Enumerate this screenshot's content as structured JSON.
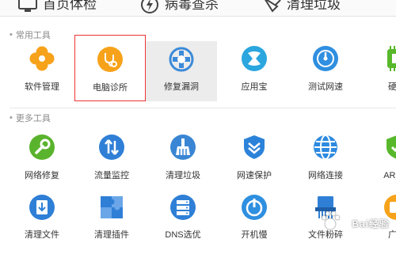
{
  "tabs": [
    {
      "label": "首页体检",
      "icon": "monitor-icon"
    },
    {
      "label": "病毒查杀",
      "icon": "lightning-shield-icon"
    },
    {
      "label": "清理垃圾",
      "icon": "broom-icon"
    }
  ],
  "sections": [
    {
      "title": "常用工具",
      "tools": [
        {
          "label": "软件管理",
          "icon": "clover-icon",
          "color": "#f7a21b"
        },
        {
          "label": "电脑诊所",
          "icon": "stethoscope-icon",
          "color": "#f7a21b",
          "selected": true
        },
        {
          "label": "修复漏洞",
          "icon": "bug-shield-icon",
          "color": "#3b8ad9",
          "hovered": true
        },
        {
          "label": "应用宝",
          "icon": "app-store-icon",
          "color": "#2ba6de"
        },
        {
          "label": "测试网速",
          "icon": "speedometer-icon",
          "color": "#2f8fe0"
        },
        {
          "label": "硬件",
          "icon": "chip-icon",
          "color": "#58b82b"
        }
      ]
    },
    {
      "title": "更多工具",
      "tools": [
        {
          "label": "网络修复",
          "icon": "wrench-icon",
          "color": "#5ab32d"
        },
        {
          "label": "流量监控",
          "icon": "up-down-arrows-icon",
          "color": "#2f7fd6"
        },
        {
          "label": "清理垃圾",
          "icon": "broom-icon",
          "color": "#3a86d4"
        },
        {
          "label": "网速保护",
          "icon": "shield-chevron-icon",
          "color": "#2b82d9"
        },
        {
          "label": "网络连接",
          "icon": "globe-icon",
          "color": "#2d8ae0"
        },
        {
          "label": "ARP防",
          "icon": "arp-shield-icon",
          "color": "#58b82b"
        }
      ]
    },
    {
      "tools": [
        {
          "label": "清理文件",
          "icon": "file-download-icon",
          "color": "#2f7fd6"
        },
        {
          "label": "清理插件",
          "icon": "puzzle-icon",
          "color": "#2f7fd6"
        },
        {
          "label": "DNS选优",
          "icon": "server-icon",
          "color": "#2f7fd6"
        },
        {
          "label": "开机慢",
          "icon": "power-clock-icon",
          "color": "#2f8fe0"
        },
        {
          "label": "文件粉碎",
          "icon": "file-shredder-icon",
          "color": "#2f7fd6"
        },
        {
          "label": "广告",
          "icon": "ad-block-icon",
          "color": "#f7a21b"
        }
      ]
    }
  ],
  "watermark": "Bai经验"
}
